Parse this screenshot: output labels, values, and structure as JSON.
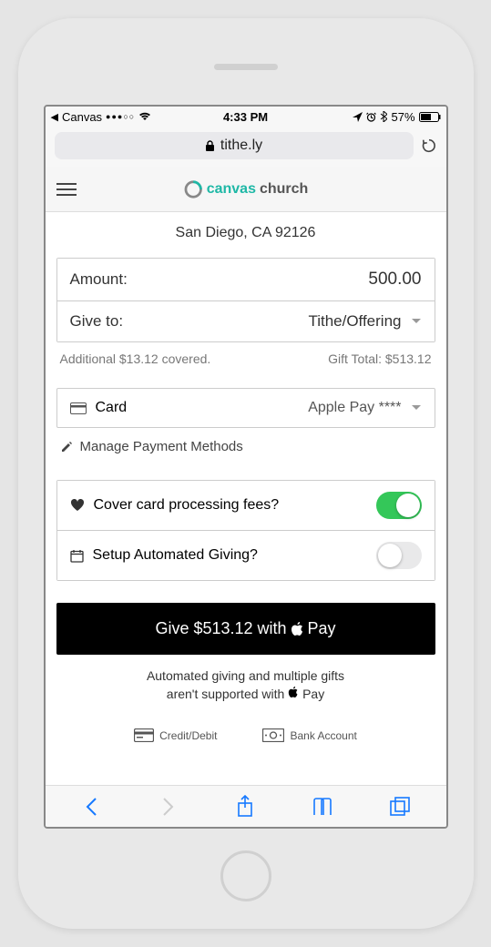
{
  "status": {
    "back_app": "Canvas",
    "carrier_dots": "●●●○○",
    "time": "4:33 PM",
    "battery_pct": "57%"
  },
  "browser": {
    "domain": "tithe.ly"
  },
  "header": {
    "logo_part1": "canvas",
    "logo_part2": "church"
  },
  "location": "San Diego, CA 92126",
  "form": {
    "amount_label": "Amount:",
    "amount_value": "500.00",
    "giveto_label": "Give to:",
    "giveto_value": "Tithe/Offering",
    "covered_text": "Additional $13.12 covered.",
    "gift_total_text": "Gift Total: $513.12"
  },
  "payment": {
    "card_label": "Card",
    "card_value": "Apple Pay ****",
    "manage_label": "Manage Payment Methods"
  },
  "toggles": {
    "cover_fees_label": "Cover card processing fees?",
    "cover_fees_on": true,
    "automated_label": "Setup Automated Giving?",
    "automated_on": false
  },
  "cta": {
    "prefix": "Give $513.12 with ",
    "suffix": " Pay"
  },
  "disclaimer": {
    "line1": "Automated giving and multiple gifts",
    "line2_a": "aren't supported with ",
    "line2_b": " Pay"
  },
  "methods": {
    "credit": "Credit/Debit",
    "bank": "Bank Account"
  }
}
